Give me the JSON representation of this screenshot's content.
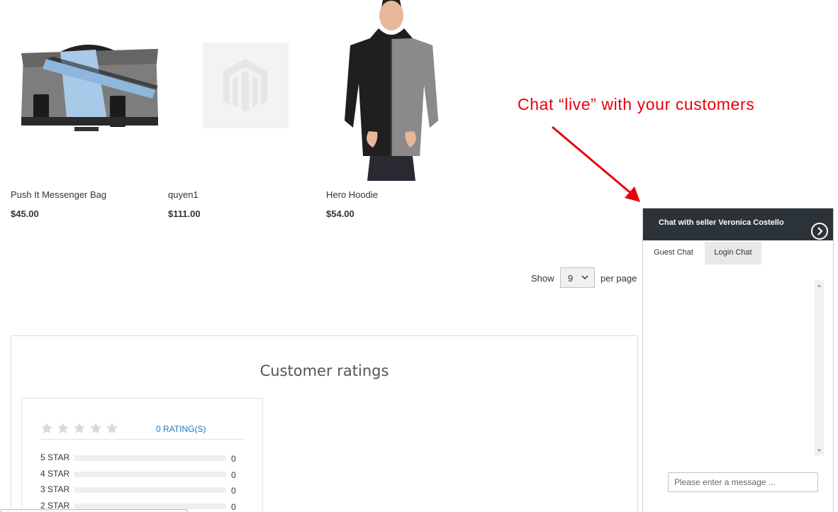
{
  "products": [
    {
      "name": "Push It Messenger Bag",
      "price": "$45.00",
      "image": "messenger-bag-image"
    },
    {
      "name": "quyen1",
      "price": "$111.00",
      "image": "placeholder-image"
    },
    {
      "name": "Hero Hoodie",
      "price": "$54.00",
      "image": "hoodie-image"
    }
  ],
  "annotation": {
    "text": "Chat “live” with your customers",
    "color": "#e8000b"
  },
  "toolbar": {
    "show_label": "Show",
    "limit_value": "9",
    "per_page_label": "per page"
  },
  "ratings": {
    "title": "Customer ratings",
    "count_link": "0 RATING(S)",
    "stars_filled": 0,
    "stars_total": 5,
    "rows": [
      {
        "label": "5 STAR",
        "count": "0",
        "fraction": 0
      },
      {
        "label": "4 STAR",
        "count": "0",
        "fraction": 0
      },
      {
        "label": "3 STAR",
        "count": "0",
        "fraction": 0
      },
      {
        "label": "2 STAR",
        "count": "0",
        "fraction": 0
      }
    ]
  },
  "chat": {
    "title": "Chat with seller Veronica Costello",
    "tabs": [
      {
        "label": "Guest Chat",
        "active": true
      },
      {
        "label": "Login Chat",
        "active": false
      }
    ],
    "input_placeholder": "Please enter a message ...",
    "header_color": "#2c3338"
  },
  "colors": {
    "link": "#1979c3",
    "text": "#333333"
  }
}
